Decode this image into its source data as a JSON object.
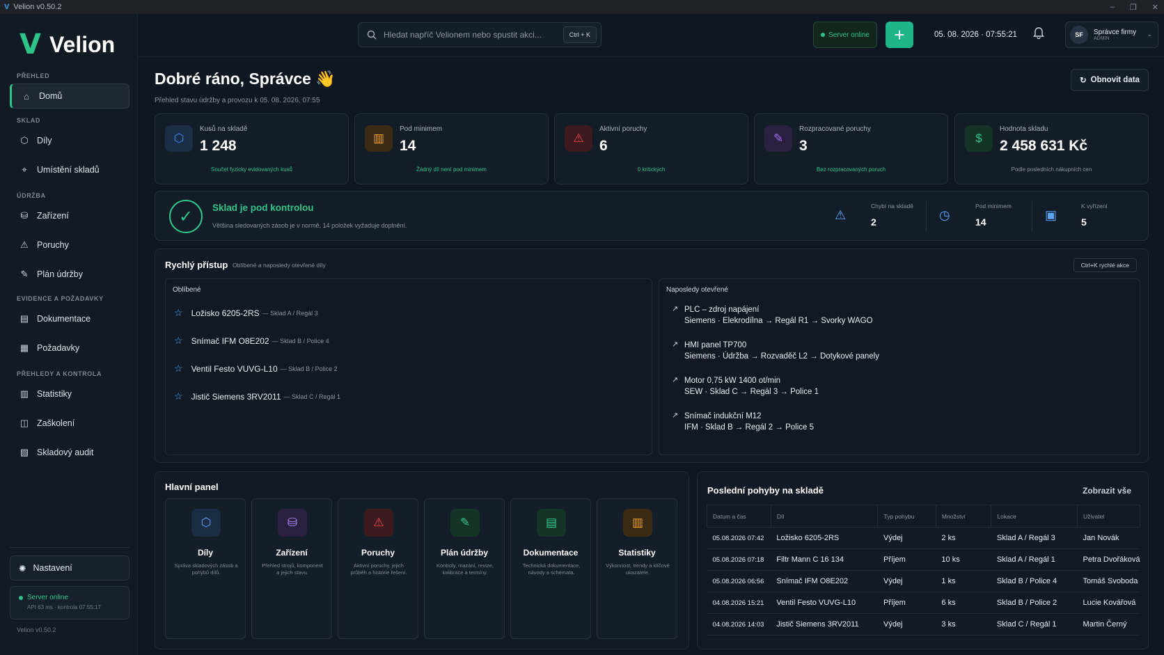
{
  "window": {
    "title": "Velion v0.50.2",
    "logo_letter": "V",
    "minimize": "–",
    "restore": "❐",
    "close": "✕"
  },
  "brand": {
    "mark": "V",
    "name": "Velion"
  },
  "sidebar": {
    "sections": [
      "PŘEHLED",
      "SKLAD",
      "ÚDRŽBA",
      "EVIDENCE A POŽADAVKY",
      "PŘEHLEDY A KONTROLA"
    ],
    "items": [
      {
        "label": "Domů",
        "icon": "home-icon",
        "glyph": "⌂",
        "active": true
      },
      {
        "label": "Díly",
        "icon": "cube-icon",
        "glyph": "⬡"
      },
      {
        "label": "Umístění skladů",
        "icon": "location-pin-icon",
        "glyph": "⌖"
      },
      {
        "label": "Zařízení",
        "icon": "machine-icon",
        "glyph": "⛁"
      },
      {
        "label": "Poruchy",
        "icon": "warning-icon",
        "glyph": "⚠"
      },
      {
        "label": "Plán údržby",
        "icon": "wrench-icon",
        "glyph": "✎"
      },
      {
        "label": "Dokumentace",
        "icon": "document-icon",
        "glyph": "▤"
      },
      {
        "label": "Požadavky",
        "icon": "clipboard-icon",
        "glyph": "▦"
      },
      {
        "label": "Statistiky",
        "icon": "bar-chart-icon",
        "glyph": "▥"
      },
      {
        "label": "Zaškolení",
        "icon": "book-icon",
        "glyph": "◫"
      },
      {
        "label": "Skladový audit",
        "icon": "audit-icon",
        "glyph": "▧"
      }
    ],
    "settings": {
      "label": "Nastavení",
      "glyph": "✺"
    },
    "server": {
      "status": "Server online",
      "detail": "API 63 ms · kontrola 07:55:17"
    },
    "version": "Velion v0.50.2"
  },
  "topbar": {
    "search_placeholder": "Hledat napříč Velionem nebo spustit akci...",
    "search_shortcut": "Ctrl + K",
    "server_status": "Server online",
    "add_glyph": "+",
    "datetime": "05. 08. 2026 · 07:55:21",
    "user": {
      "initials": "SF",
      "name": "Správce firmy",
      "role": "ADMIN"
    }
  },
  "header": {
    "greeting": "Dobré ráno, Správce",
    "wave": "👋",
    "subtitle": "Přehled stavu údržby a provozu k 05. 08. 2026, 07:55",
    "refresh_label": "Obnovit data"
  },
  "kpis": [
    {
      "label": "Kusů na skladě",
      "value": "1 248",
      "sub": "Součet fyzicky evidovaných kusů",
      "icon": "cube-icon",
      "glyph": "⬡",
      "color": "#3a8eff",
      "bg": "#1b2d44",
      "sub_color": "#2fc58a"
    },
    {
      "label": "Pod minimem",
      "value": "14",
      "sub": "Žádný díl není pod minimem",
      "icon": "bar-chart-icon",
      "glyph": "▥",
      "color": "#f0a020",
      "bg": "#3a2a14",
      "sub_color": "#2fc58a"
    },
    {
      "label": "Aktivní poruchy",
      "value": "6",
      "sub": "0 kritických",
      "icon": "warning-icon",
      "glyph": "⚠",
      "color": "#f04848",
      "bg": "#3c1a1e",
      "sub_color": "#2fc58a"
    },
    {
      "label": "Rozpracované poruchy",
      "value": "3",
      "sub": "Bez rozpracovaných poruch",
      "icon": "wrench-icon",
      "glyph": "✎",
      "color": "#a070f0",
      "bg": "#2a2040",
      "sub_color": "#2fc58a"
    },
    {
      "label": "Hodnota skladu",
      "value": "2 458 631 Kč",
      "sub": "Podle posledních nákupních cen",
      "icon": "money-icon",
      "glyph": "$",
      "color": "#2fc58a",
      "bg": "#153428",
      "sub_color": "#8b96a1"
    }
  ],
  "status": {
    "title": "Sklad je pod kontrolou",
    "desc": "Většina sledovaných zásob je v normě, 14 položek vyžaduje doplnění.",
    "check": "✓",
    "stats": [
      {
        "label": "Chybí na skladě",
        "value": "2",
        "icon": "warning-triangle-icon",
        "glyph": "⚠",
        "color": "#5aa6ff"
      },
      {
        "label": "Pod minimem",
        "value": "14",
        "icon": "clock-icon",
        "glyph": "◷",
        "color": "#5aa6ff"
      },
      {
        "label": "K vyřízení",
        "value": "5",
        "icon": "clipboard-check-icon",
        "glyph": "▣",
        "color": "#5aa6ff"
      }
    ]
  },
  "quick_access": {
    "title": "Rychlý přístup",
    "subtitle": "Oblíbené a naposledy otevřené díly",
    "shortcut": "Ctrl+K  rychlé akce",
    "favorites_title": "Oblíbené",
    "favorites": [
      {
        "name": "Ložisko 6205-2RS",
        "loc": "— Sklad A / Regál 3"
      },
      {
        "name": "Snímač IFM O8E202",
        "loc": "— Sklad B / Police 4"
      },
      {
        "name": "Ventil Festo VUVG-L10",
        "loc": "— Sklad B / Police 2"
      },
      {
        "name": "Jistič Siemens 3RV2011",
        "loc": "— Sklad C / Regál 1"
      }
    ],
    "recent_title": "Naposledy otevřené",
    "recent": [
      {
        "name": "PLC – zdroj napájení",
        "path": "Siemens · Elekrodílna → Regál R1 → Svorky WAGO"
      },
      {
        "name": "HMI panel TP700",
        "path": "Siemens · Údržba → Rozvaděč L2 → Dotykové panely"
      },
      {
        "name": "Motor 0,75 kW 1400 ot/min",
        "path": "SEW · Sklad C → Regál 3 → Police 1"
      },
      {
        "name": "Snímač indukční M12",
        "path": "IFM · Sklad B → Regál 2 → Police 5"
      }
    ]
  },
  "main_panel": {
    "title": "Hlavní panel",
    "tiles": [
      {
        "title": "Díly",
        "desc": "Správa skladových zásob a pohybů dílů.",
        "icon": "cube-icon",
        "glyph": "⬡",
        "color": "#5aa6ff",
        "bg": "#1b2d44"
      },
      {
        "title": "Zařízení",
        "desc": "Přehled strojů, komponent a jejich stavu.",
        "icon": "machine-icon",
        "glyph": "⛁",
        "color": "#b08af5",
        "bg": "#2a2040"
      },
      {
        "title": "Poruchy",
        "desc": "Aktivní poruchy, jejich průběh a historie řešení.",
        "icon": "warning-icon",
        "glyph": "⚠",
        "color": "#f04848",
        "bg": "#3c1a1e"
      },
      {
        "title": "Plán údržby",
        "desc": "Kontroly, mazání, revize, kalibrace a termíny.",
        "icon": "wrench-icon",
        "glyph": "✎",
        "color": "#2fc58a",
        "bg": "#153428"
      },
      {
        "title": "Dokumentace",
        "desc": "Technická dokumentace, návody a schémata.",
        "icon": "document-icon",
        "glyph": "▤",
        "color": "#2fc58a",
        "bg": "#153428"
      },
      {
        "title": "Statistiky",
        "desc": "Výkonnost, trendy a klíčové ukazatele.",
        "icon": "bar-chart-icon",
        "glyph": "▥",
        "color": "#f0a020",
        "bg": "#3a2a14"
      }
    ]
  },
  "movements": {
    "title": "Poslední pohyby na skladě",
    "show_all": "Zobrazit vše",
    "columns": [
      "Datum a čas",
      "Díl",
      "Typ pohybu",
      "Množství",
      "Lokace",
      "Uživatel"
    ],
    "rows": [
      [
        "05.08.2026 07:42",
        "Ložisko 6205-2RS",
        "Výdej",
        "2 ks",
        "Sklad A / Regál 3",
        "Jan Novák"
      ],
      [
        "05.08.2026 07:18",
        "Filtr Mann C 16 134",
        "Příjem",
        "10 ks",
        "Sklad A / Regál 1",
        "Petra Dvořáková"
      ],
      [
        "05.08.2026 06:56",
        "Snímač IFM O8E202",
        "Výdej",
        "1 ks",
        "Sklad B / Police 4",
        "Tomáš Svoboda"
      ],
      [
        "04.08.2026 15:21",
        "Ventil Festo VUVG-L10",
        "Příjem",
        "6 ks",
        "Sklad B / Police 2",
        "Lucie Kovářová"
      ],
      [
        "04.08.2026 14:03",
        "Jistič Siemens 3RV2011",
        "Výdej",
        "3 ks",
        "Sklad C / Regál 1",
        "Martin Černý"
      ]
    ]
  }
}
